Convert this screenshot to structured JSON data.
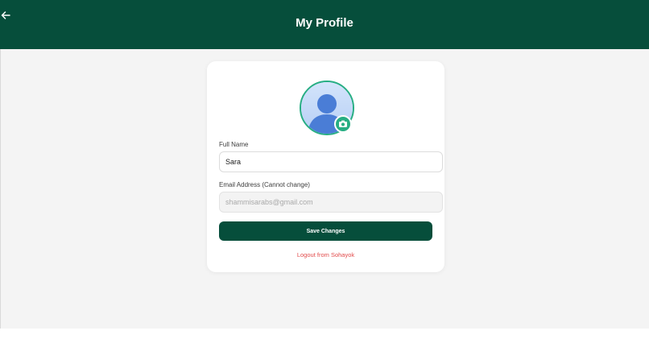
{
  "header": {
    "title": "My Profile",
    "back_icon": "arrow-left-icon",
    "background_color": "#064e3b"
  },
  "profile": {
    "avatar_icon": "user-avatar-icon",
    "camera_icon": "camera-icon",
    "full_name": {
      "label": "Full Name",
      "value": "Sara"
    },
    "email": {
      "label": "Email Address (Cannot change)",
      "value": "shammisarabs@gmail.com"
    },
    "save_label": "Save Changes",
    "logout_label": "Logout from Sohayok"
  },
  "colors": {
    "primary": "#064e3b",
    "accent": "#27ae83",
    "danger": "#e24b4b"
  }
}
